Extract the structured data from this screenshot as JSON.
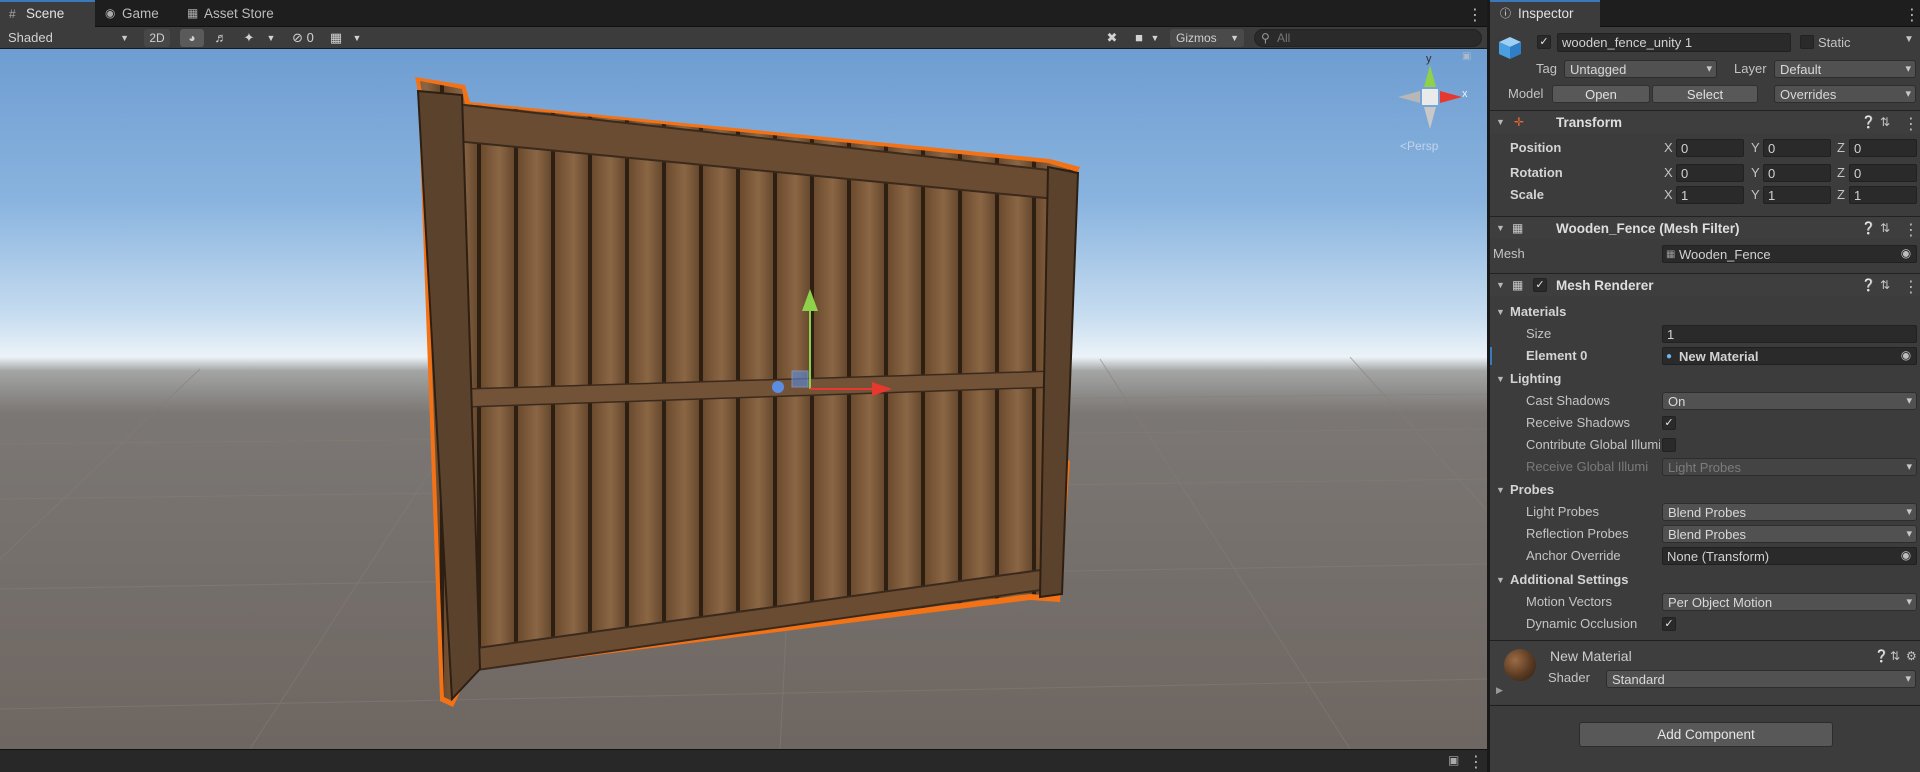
{
  "scene_tabs": [
    {
      "label": "Scene",
      "icon": "grid-icon"
    },
    {
      "label": "Game",
      "icon": "gamepad-icon"
    },
    {
      "label": "Asset Store",
      "icon": "shop-icon"
    }
  ],
  "scene_toolbar": {
    "draw_mode": "Shaded",
    "mode_2d": "2D",
    "hidden_count": "0",
    "gizmos_label": "Gizmos",
    "search_placeholder": "All"
  },
  "gizmo": {
    "y_label": "y",
    "x_label": "x",
    "persp_label": "Persp"
  },
  "inspector": {
    "tab_label": "Inspector",
    "object_name": "wooden_fence_unity 1",
    "static_label": "Static",
    "tag_label": "Tag",
    "tag_value": "Untagged",
    "layer_label": "Layer",
    "layer_value": "Default",
    "model_label": "Model",
    "open_label": "Open",
    "select_label": "Select",
    "overrides_label": "Overrides",
    "transform": {
      "title": "Transform",
      "position_label": "Position",
      "rotation_label": "Rotation",
      "scale_label": "Scale",
      "axis_x": "X",
      "axis_y": "Y",
      "axis_z": "Z",
      "position": {
        "x": "0",
        "y": "0",
        "z": "0"
      },
      "rotation": {
        "x": "0",
        "y": "0",
        "z": "0"
      },
      "scale": {
        "x": "1",
        "y": "1",
        "z": "1"
      }
    },
    "mesh_filter": {
      "title": "Wooden_Fence (Mesh Filter)",
      "mesh_label": "Mesh",
      "mesh_value": "Wooden_Fence"
    },
    "mesh_renderer": {
      "title": "Mesh Renderer",
      "materials_label": "Materials",
      "size_label": "Size",
      "size_value": "1",
      "element0_label": "Element 0",
      "element0_value": "New Material",
      "lighting_label": "Lighting",
      "cast_shadows_label": "Cast Shadows",
      "cast_shadows_value": "On",
      "receive_shadows_label": "Receive Shadows",
      "contribute_gi_label": "Contribute Global Illumi",
      "receive_gi_label": "Receive Global Illumi",
      "receive_gi_value": "Light Probes",
      "probes_label": "Probes",
      "light_probes_label": "Light Probes",
      "light_probes_value": "Blend Probes",
      "reflection_probes_label": "Reflection Probes",
      "reflection_probes_value": "Blend Probes",
      "anchor_override_label": "Anchor Override",
      "anchor_override_value": "None (Transform)",
      "additional_label": "Additional Settings",
      "motion_vectors_label": "Motion Vectors",
      "motion_vectors_value": "Per Object Motion",
      "dynamic_occlusion_label": "Dynamic Occlusion"
    },
    "material": {
      "name": "New Material",
      "shader_label": "Shader",
      "shader_value": "Standard"
    },
    "add_component_label": "Add Component"
  },
  "colors": {
    "accent": "#3a79bb",
    "selection_outline": "#f47216",
    "axis_x": "#e6382e",
    "axis_y": "#8fd14a",
    "axis_z": "#5b8de0"
  }
}
